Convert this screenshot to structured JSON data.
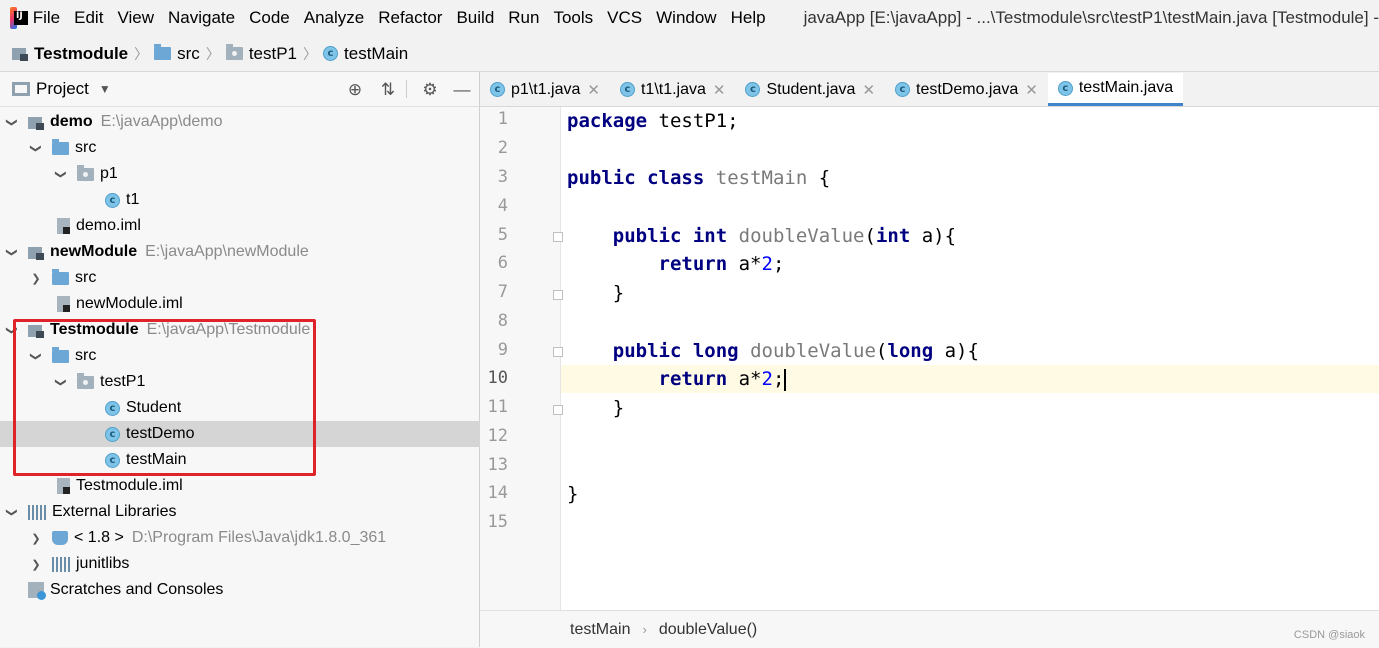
{
  "menubar": {
    "items": [
      "File",
      "Edit",
      "View",
      "Navigate",
      "Code",
      "Analyze",
      "Refactor",
      "Build",
      "Run",
      "Tools",
      "VCS",
      "Window",
      "Help"
    ],
    "window_title": "javaApp [E:\\javaApp] - ...\\Testmodule\\src\\testP1\\testMain.java [Testmodule] -"
  },
  "breadcrumb": {
    "module": "Testmodule",
    "src": "src",
    "package": "testP1",
    "file": "testMain"
  },
  "project_panel": {
    "title": "Project",
    "tree": [
      {
        "label": "demo",
        "hint": "E:\\javaApp\\demo",
        "icon": "module-icon",
        "arrow": "down",
        "bold": true
      },
      {
        "label": "src",
        "icon": "folder-blue",
        "arrow": "down"
      },
      {
        "label": "p1",
        "icon": "folder-gray",
        "arrow": "down"
      },
      {
        "label": "t1",
        "icon": "class-icon"
      },
      {
        "label": "demo.iml",
        "icon": "iml-icon"
      },
      {
        "label": "newModule",
        "hint": "E:\\javaApp\\newModule",
        "icon": "module-icon",
        "arrow": "down",
        "bold": true
      },
      {
        "label": "src",
        "icon": "folder-blue",
        "arrow": "right"
      },
      {
        "label": "newModule.iml",
        "icon": "iml-icon"
      },
      {
        "label": "Testmodule",
        "hint": "E:\\javaApp\\Testmodule",
        "icon": "module-icon",
        "arrow": "down",
        "bold": true
      },
      {
        "label": "src",
        "icon": "folder-blue",
        "arrow": "down"
      },
      {
        "label": "testP1",
        "icon": "folder-gray",
        "arrow": "down"
      },
      {
        "label": "Student",
        "icon": "class-icon"
      },
      {
        "label": "testDemo",
        "icon": "class-icon",
        "selected": true
      },
      {
        "label": "testMain",
        "icon": "class-icon"
      },
      {
        "label": "Testmodule.iml",
        "icon": "iml-icon"
      },
      {
        "label": "External Libraries",
        "icon": "libs-icon",
        "arrow": "down"
      },
      {
        "label": "< 1.8 >",
        "hint": "D:\\Program Files\\Java\\jdk1.8.0_361",
        "icon": "jdk-icon",
        "arrow": "right"
      },
      {
        "label": "junitlibs",
        "icon": "libs-icon",
        "arrow": "right"
      },
      {
        "label": "Scratches and Consoles",
        "icon": "scratch-icon"
      }
    ]
  },
  "tabs": [
    {
      "label": "p1\\t1.java",
      "active": false
    },
    {
      "label": "t1\\t1.java",
      "active": false
    },
    {
      "label": "Student.java",
      "active": false
    },
    {
      "label": "testDemo.java",
      "active": false
    },
    {
      "label": "testMain.java",
      "active": true
    }
  ],
  "editor": {
    "line_numbers": [
      "1",
      "2",
      "3",
      "4",
      "5",
      "6",
      "7",
      "8",
      "9",
      "10",
      "11",
      "12",
      "13",
      "14",
      "15"
    ],
    "current_line": "10",
    "code": {
      "l1_kw": "package",
      "l1_rest": " testP1;",
      "l3_kw1": "public",
      "l3_kw2": "class",
      "l3_name": "testMain",
      "l3_rest": " {",
      "l5_kw1": "public",
      "l5_kw2": "int",
      "l5_fn": "doubleValue",
      "l5_p": "(",
      "l5_kw3": "int",
      "l5_rest": " a){",
      "l6_kw": "return",
      "l6_a": " a*",
      "l6_num": "2",
      "l6_end": ";",
      "l7": "}",
      "l9_kw1": "public",
      "l9_kw2": "long",
      "l9_fn": "doubleValue",
      "l9_p": "(",
      "l9_kw3": "long",
      "l9_rest": " a){",
      "l10_kw": "return",
      "l10_a": " a*",
      "l10_num": "2",
      "l10_end": ";",
      "l11": "}",
      "l14": "}"
    },
    "breadcrumb": [
      "testMain",
      "doubleValue()"
    ]
  },
  "watermark": "CSDN @siaok"
}
